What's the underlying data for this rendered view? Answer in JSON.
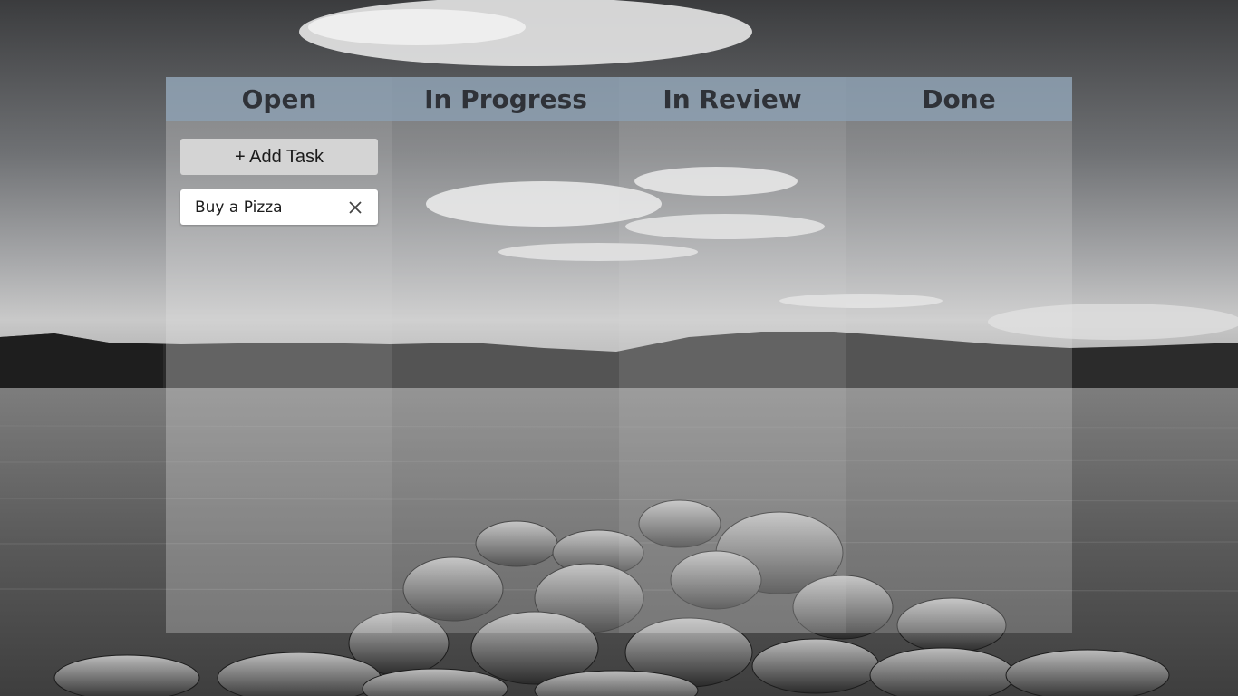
{
  "board": {
    "columns": [
      {
        "title": "Open"
      },
      {
        "title": "In Progress"
      },
      {
        "title": "In Review"
      },
      {
        "title": "Done"
      }
    ]
  },
  "open_column": {
    "add_button_label": "+ Add Task",
    "tasks": [
      {
        "text": "Buy a Pizza",
        "delete_icon": "close-icon"
      }
    ]
  },
  "colors": {
    "header_bg": "#8ca0b4",
    "header_text": "#2f3238",
    "card_bg": "#ffffff",
    "button_bg": "#d4d4d4"
  },
  "background": {
    "icon": "landscape-photo"
  }
}
